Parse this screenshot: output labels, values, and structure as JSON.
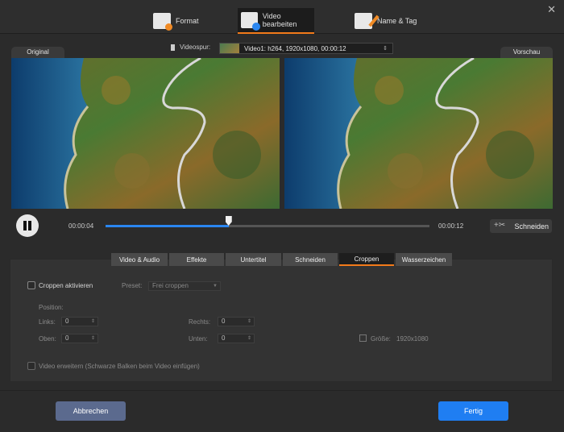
{
  "window": {
    "close_label": "✕"
  },
  "top_tabs": [
    {
      "label": "Format",
      "icon": "format-doc-gear-icon"
    },
    {
      "label": "Video bearbeiten",
      "icon": "video-edit-scissors-icon",
      "active": true
    },
    {
      "label": "Name & Tag",
      "icon": "name-tag-pen-icon"
    }
  ],
  "preview": {
    "original_label": "Original",
    "preview_label": "Vorschau",
    "track_label": "Videospur:",
    "track_value": "Video1: h264, 1920x1080, 00:00:12"
  },
  "player": {
    "current_time": "00:00:04",
    "total_time": "00:00:12",
    "progress": 0.38,
    "cut_label": "Schneiden"
  },
  "edit_tabs": [
    {
      "label": "Video & Audio",
      "active": false
    },
    {
      "label": "Effekte",
      "active": false
    },
    {
      "label": "Untertitel",
      "active": false
    },
    {
      "label": "Schneiden",
      "active": false
    },
    {
      "label": "Croppen",
      "active": true
    },
    {
      "label": "Wasserzeichen",
      "active": false
    }
  ],
  "crop": {
    "enable_label": "Croppen aktivieren",
    "preset_label": "Preset:",
    "preset_value": "Frei croppen",
    "position_label": "Position:",
    "left_label": "Links:",
    "left_value": "0",
    "right_label": "Rechts:",
    "right_value": "0",
    "top_label": "Oben:",
    "top_value": "0",
    "bottom_label": "Unten:",
    "bottom_value": "0",
    "size_label": "Größe:",
    "size_value": "1920x1080",
    "expand_label": "Video erweitern (Schwarze Balken beim Video einfügen)"
  },
  "buttons": {
    "cancel": "Abbrechen",
    "done": "Fertig"
  },
  "colors": {
    "accent_orange": "#f27a1a",
    "accent_blue": "#1f7ef2",
    "cancel_btn": "#5b6a8e"
  }
}
